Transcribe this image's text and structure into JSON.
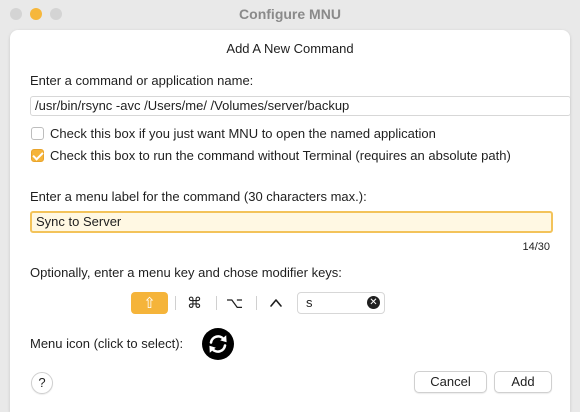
{
  "window": {
    "title": "Configure MNU"
  },
  "sheet": {
    "title": "Add A New Command",
    "command_prompt": "Enter a command or application name:",
    "command_value": "/usr/bin/rsync -avc /Users/me/ /Volumes/server/backup",
    "open_app_checkbox": {
      "label": "Check this box if you just want MNU to open the named application",
      "checked": false
    },
    "no_terminal_checkbox": {
      "label": "Check this box to run the command without Terminal (requires an absolute path)",
      "checked": true
    },
    "label_prompt": "Enter a menu label for the command (30 characters max.):",
    "label_value": "Sync to Server",
    "char_counter": "14/30",
    "key_prompt": "Optionally, enter a menu key and chose modifier keys:",
    "modifiers": [
      {
        "symbol": "⇧",
        "name": "shift",
        "active": true
      },
      {
        "symbol": "⌘",
        "name": "command",
        "active": false
      },
      {
        "symbol": "⌥",
        "name": "option",
        "active": false
      },
      {
        "symbol": "^",
        "name": "control",
        "active": false
      }
    ],
    "menu_key_value": "s",
    "icon_prompt": "Menu icon (click to select):",
    "icon_name": "sync-icon"
  },
  "footer": {
    "help_label": "?",
    "cancel_label": "Cancel",
    "add_label": "Add"
  },
  "colors": {
    "accent": "#f5b43a",
    "focus_ring": "#f3c35a",
    "field_focus_bg": "#fff8e3"
  }
}
